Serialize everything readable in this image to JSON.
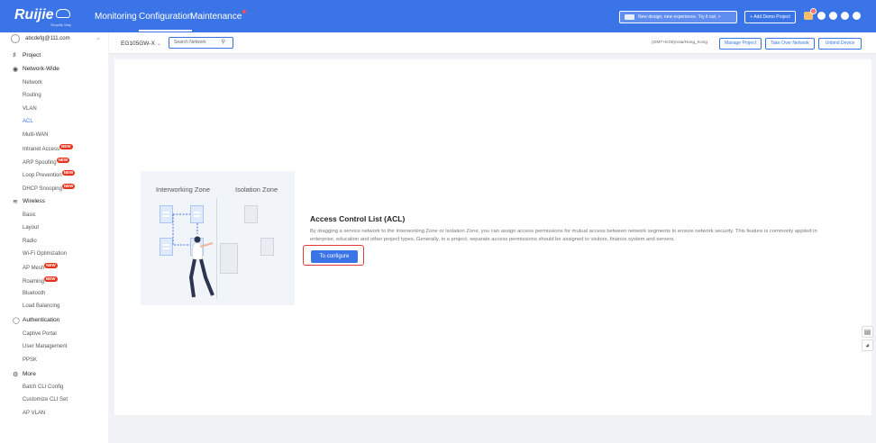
{
  "brand": {
    "logo_text": "Ruijie",
    "logo_sub": "Simplify Way"
  },
  "topnav": {
    "items": [
      {
        "label": "Monitoring"
      },
      {
        "label": "Configuration"
      },
      {
        "label": "Maintenance"
      }
    ],
    "promo": "New design, new experience. Try it out.",
    "promo_arrow": ">",
    "add_demo": "+ Add Demo Project",
    "notification_count": "5",
    "accent_color": "#3a74e6",
    "icons": [
      "gift-icon",
      "message-icon",
      "help-icon",
      "settings-icon",
      "user-icon"
    ]
  },
  "sidebar": {
    "account": "abcdefg@111.com",
    "project": "Project",
    "groups": [
      {
        "label": "Network-Wide",
        "items": [
          "Network",
          "Routing",
          "VLAN",
          "ACL",
          "Multi-WAN",
          "Intranet Access",
          "ARP Spoofing",
          "Loop Prevention",
          "DHCP Snooping"
        ]
      },
      {
        "label": "Wireless",
        "items": [
          "Basic",
          "Layout",
          "Radio",
          "Wi-Fi Optimization",
          "AP Mesh",
          "Roaming",
          "Bluetooth",
          "Load Balancing"
        ]
      },
      {
        "label": "Authentication",
        "items": [
          "Captive Portal",
          "User Management",
          "PPSK"
        ]
      },
      {
        "label": "More",
        "items": [
          "Batch CLI Config",
          "Customize CLI Set",
          "AP VLAN"
        ]
      }
    ],
    "new_badge": "NEW",
    "active_item": "ACL"
  },
  "toolbar": {
    "device": "EG105GW-X",
    "search_placeholder": "Search Network",
    "timezone": "(GMT+8:00)Asia/Hong_Kong",
    "manage_project": "Manage Project",
    "take_over": "Take Over Network",
    "unbind": "Unbind Device"
  },
  "main": {
    "zone_left": "Interworking Zone",
    "zone_right": "Isolation Zone",
    "title": "Access Control List (ACL)",
    "description": "By dragging a service network to the Interworking Zone or Isolation Zone, you can assign access permissions for mutual access between network segments to ensure network security. This feature is commonly applied in enterprise, education and other project types. Generally, in a project, separate access permissions should be assigned to visitors, finance system and servers.",
    "configure_button": "To configure"
  }
}
